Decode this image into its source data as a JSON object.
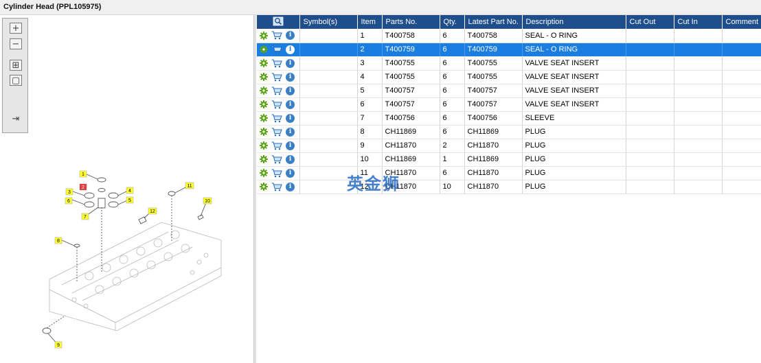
{
  "window": {
    "title": "Cylinder Head (PPL105975)"
  },
  "toolbox": [
    {
      "name": "zoom-in-icon",
      "glyph": "+"
    },
    {
      "name": "zoom-out-icon",
      "glyph": "−"
    },
    {
      "name": "fit-all-icon",
      "glyph": "⊞"
    },
    {
      "name": "fit-window-icon",
      "glyph": "▢"
    },
    {
      "name": "export-icon",
      "glyph": "⇥"
    }
  ],
  "callouts": [
    "1",
    "2",
    "3",
    "4",
    "5",
    "6",
    "7",
    "8",
    "9",
    "10",
    "11",
    "12"
  ],
  "table": {
    "columns": [
      "",
      "Symbol(s)",
      "Item",
      "Parts No.",
      "Qty.",
      "Latest Part No.",
      "Description",
      "Cut Out",
      "Cut In",
      "Comment"
    ],
    "header_icon": "search-icon",
    "row_icons": [
      "gear-icon",
      "cart-icon",
      "info-icon"
    ],
    "info_glyph": "i",
    "rows": [
      {
        "symbol": "",
        "item": "1",
        "part_no": "T400758",
        "qty": "6",
        "latest": "T400758",
        "desc": "SEAL - O RING",
        "cut_out": "",
        "cut_in": "",
        "comment": ""
      },
      {
        "symbol": "",
        "item": "2",
        "part_no": "T400759",
        "qty": "6",
        "latest": "T400759",
        "desc": "SEAL - O RING",
        "cut_out": "",
        "cut_in": "",
        "comment": "",
        "selected": true
      },
      {
        "symbol": "",
        "item": "3",
        "part_no": "T400755",
        "qty": "6",
        "latest": "T400755",
        "desc": "VALVE SEAT INSERT",
        "cut_out": "",
        "cut_in": "",
        "comment": ""
      },
      {
        "symbol": "",
        "item": "4",
        "part_no": "T400755",
        "qty": "6",
        "latest": "T400755",
        "desc": "VALVE SEAT INSERT",
        "cut_out": "",
        "cut_in": "",
        "comment": ""
      },
      {
        "symbol": "",
        "item": "5",
        "part_no": "T400757",
        "qty": "6",
        "latest": "T400757",
        "desc": "VALVE SEAT INSERT",
        "cut_out": "",
        "cut_in": "",
        "comment": ""
      },
      {
        "symbol": "",
        "item": "6",
        "part_no": "T400757",
        "qty": "6",
        "latest": "T400757",
        "desc": "VALVE SEAT INSERT",
        "cut_out": "",
        "cut_in": "",
        "comment": ""
      },
      {
        "symbol": "",
        "item": "7",
        "part_no": "T400756",
        "qty": "6",
        "latest": "T400756",
        "desc": "SLEEVE",
        "cut_out": "",
        "cut_in": "",
        "comment": ""
      },
      {
        "symbol": "",
        "item": "8",
        "part_no": "CH11869",
        "qty": "6",
        "latest": "CH11869",
        "desc": "PLUG",
        "cut_out": "",
        "cut_in": "",
        "comment": ""
      },
      {
        "symbol": "",
        "item": "9",
        "part_no": "CH11870",
        "qty": "2",
        "latest": "CH11870",
        "desc": "PLUG",
        "cut_out": "",
        "cut_in": "",
        "comment": ""
      },
      {
        "symbol": "",
        "item": "10",
        "part_no": "CH11869",
        "qty": "1",
        "latest": "CH11869",
        "desc": "PLUG",
        "cut_out": "",
        "cut_in": "",
        "comment": ""
      },
      {
        "symbol": "",
        "item": "11",
        "part_no": "CH11870",
        "qty": "6",
        "latest": "CH11870",
        "desc": "PLUG",
        "cut_out": "",
        "cut_in": "",
        "comment": ""
      },
      {
        "symbol": "",
        "item": "12",
        "part_no": "CH11870",
        "qty": "10",
        "latest": "CH11870",
        "desc": "PLUG",
        "cut_out": "",
        "cut_in": "",
        "comment": ""
      }
    ]
  },
  "watermark": "英金狮",
  "colors": {
    "header": "#1f4e8c",
    "selected": "#1a7ee0",
    "callout": "#ffff33",
    "callout_active": "#e03c3c"
  }
}
